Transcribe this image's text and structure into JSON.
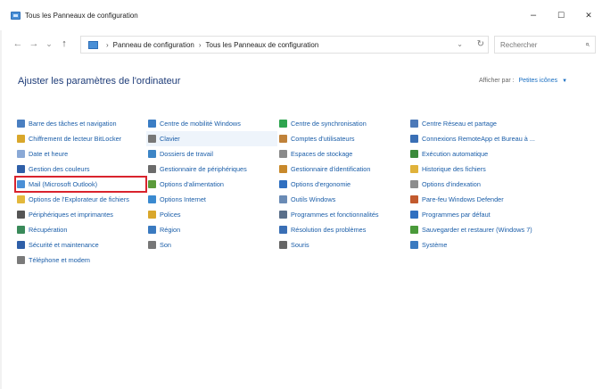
{
  "window": {
    "title": "Tous les Panneaux de configuration",
    "minimize": "–",
    "maximize": "☐",
    "close": "✕"
  },
  "nav": {
    "back": "←",
    "forward": "→",
    "recent": "⌄",
    "up": "↑"
  },
  "address": {
    "crumbs": [
      "Panneau de configuration",
      "Tous les Panneaux de configuration"
    ],
    "separator": "›",
    "dropdown": "⌄",
    "refresh": "↻"
  },
  "search": {
    "placeholder": "Rechercher",
    "icon": "⌕"
  },
  "page": {
    "heading": "Ajuster les paramètres de l'ordinateur",
    "view_by_label": "Afficher par :",
    "view_by_value": "Petites icônes",
    "view_by_arrow": "▼"
  },
  "items": [
    {
      "label": "Barre des tâches et navigation",
      "icon": "taskbar-icon",
      "color": "#4a7fc1"
    },
    {
      "label": "Centre de mobilité Windows",
      "icon": "mobility-icon",
      "color": "#3b7dc4"
    },
    {
      "label": "Centre de synchronisation",
      "icon": "sync-icon",
      "color": "#2ea44f"
    },
    {
      "label": "Centre Réseau et partage",
      "icon": "network-icon",
      "color": "#4c79b8"
    },
    {
      "label": "Chiffrement de lecteur BitLocker",
      "icon": "bitlocker-icon",
      "color": "#d9a72b"
    },
    {
      "label": "Clavier",
      "icon": "keyboard-icon",
      "color": "#777777"
    },
    {
      "label": "Comptes d'utilisateurs",
      "icon": "users-icon",
      "color": "#c0823a"
    },
    {
      "label": "Connexions RemoteApp et Bureau à ...",
      "icon": "remoteapp-icon",
      "color": "#3a6fb5"
    },
    {
      "label": "Date et heure",
      "icon": "clock-icon",
      "color": "#8aa9d6"
    },
    {
      "label": "Dossiers de travail",
      "icon": "work-folders-icon",
      "color": "#3d85c6"
    },
    {
      "label": "Espaces de stockage",
      "icon": "storage-icon",
      "color": "#8a8a8a"
    },
    {
      "label": "Exécution automatique",
      "icon": "autoplay-icon",
      "color": "#3b8a3b"
    },
    {
      "label": "Gestion des couleurs",
      "icon": "color-management-icon",
      "color": "#2f5fa8"
    },
    {
      "label": "Gestionnaire de périphériques",
      "icon": "device-manager-icon",
      "color": "#6b6b6b"
    },
    {
      "label": "Gestionnaire d'identification",
      "icon": "credential-icon",
      "color": "#c8892b"
    },
    {
      "label": "Historique des fichiers",
      "icon": "file-history-icon",
      "color": "#e0b23a"
    },
    {
      "label": "Mail (Microsoft Outlook)",
      "icon": "mail-icon",
      "color": "#4a8fd6"
    },
    {
      "label": "Options d'alimentation",
      "icon": "power-icon",
      "color": "#5a9a3a"
    },
    {
      "label": "Options d'ergonomie",
      "icon": "ease-of-access-icon",
      "color": "#2f6fc0"
    },
    {
      "label": "Options d'indexation",
      "icon": "indexing-icon",
      "color": "#8c8c8c"
    },
    {
      "label": "Options de l'Explorateur de fichiers",
      "icon": "explorer-options-icon",
      "color": "#e3b83c"
    },
    {
      "label": "Options Internet",
      "icon": "internet-icon",
      "color": "#3a8ad0"
    },
    {
      "label": "Outils Windows",
      "icon": "tools-icon",
      "color": "#6a8bb5"
    },
    {
      "label": "Pare-feu Windows Defender",
      "icon": "firewall-icon",
      "color": "#c25a2e"
    },
    {
      "label": "Périphériques et imprimantes",
      "icon": "printer-icon",
      "color": "#555555"
    },
    {
      "label": "Polices",
      "icon": "fonts-icon",
      "color": "#d9a72b"
    },
    {
      "label": "Programmes et fonctionnalités",
      "icon": "programs-icon",
      "color": "#5a6f8a"
    },
    {
      "label": "Programmes par défaut",
      "icon": "default-programs-icon",
      "color": "#2f6fc0"
    },
    {
      "label": "Récupération",
      "icon": "recovery-icon",
      "color": "#3a8a5a"
    },
    {
      "label": "Région",
      "icon": "region-icon",
      "color": "#3a7ac0"
    },
    {
      "label": "Résolution des problèmes",
      "icon": "troubleshoot-icon",
      "color": "#3a6fb5"
    },
    {
      "label": "Sauvegarder et restaurer (Windows 7)",
      "icon": "backup-icon",
      "color": "#4a9a3a"
    },
    {
      "label": "Sécurité et maintenance",
      "icon": "security-flag-icon",
      "color": "#2f5fa8"
    },
    {
      "label": "Son",
      "icon": "sound-icon",
      "color": "#777777"
    },
    {
      "label": "Souris",
      "icon": "mouse-icon",
      "color": "#666666"
    },
    {
      "label": "Système",
      "icon": "system-icon",
      "color": "#3a7ac0"
    },
    {
      "label": "Téléphone et modem",
      "icon": "phone-modem-icon",
      "color": "#7a7a7a"
    }
  ]
}
